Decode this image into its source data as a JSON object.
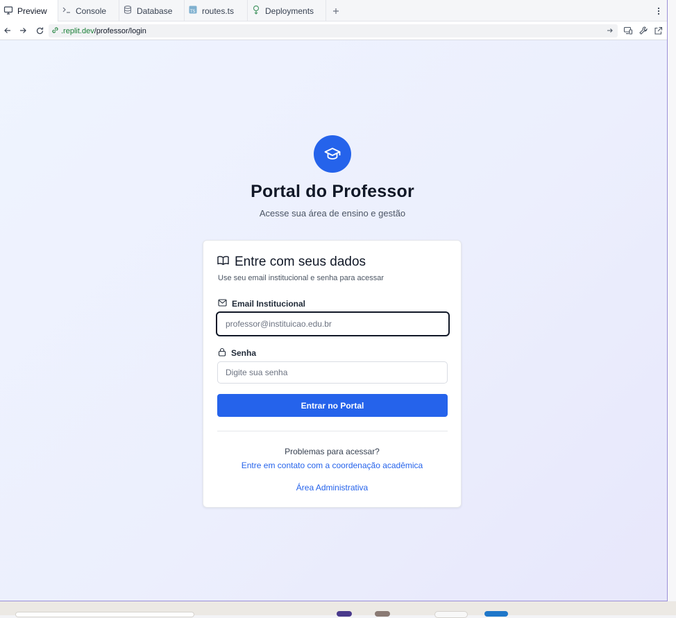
{
  "tabs": [
    {
      "label": "Preview",
      "icon": "monitor-icon",
      "active": true
    },
    {
      "label": "Console",
      "icon": "terminal-icon"
    },
    {
      "label": "Database",
      "icon": "database-icon"
    },
    {
      "label": "routes.ts",
      "icon": "typescript-file-icon"
    },
    {
      "label": "Deployments",
      "icon": "deployments-icon"
    }
  ],
  "url": {
    "host": ".replit.dev",
    "path": "/professor/login"
  },
  "page": {
    "title": "Portal do Professor",
    "subtitle": "Acesse sua área de ensino e gestão"
  },
  "card": {
    "title": "Entre com seus dados",
    "description": "Use seu email institucional e senha para acessar",
    "email_label": "Email Institucional",
    "email_placeholder": "professor@instituicao.edu.br",
    "password_label": "Senha",
    "password_placeholder": "Digite sua senha",
    "submit_label": "Entrar no Portal",
    "help_question": "Problemas para acessar?",
    "help_link": "Entre em contato com a coordenação acadêmica",
    "admin_link": "Área Administrativa"
  },
  "colors": {
    "primary": "#2563eb",
    "background_gradient_start": "#eff4fe",
    "background_gradient_end": "#e7e7fb",
    "text": "#111827"
  }
}
